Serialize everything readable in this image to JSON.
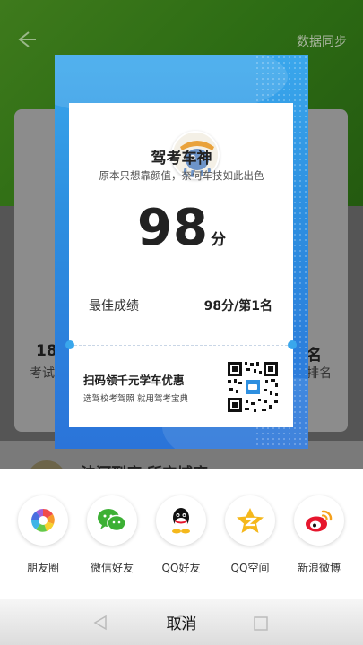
{
  "background": {
    "sync_label": "数据同步",
    "stat_left_value": "18",
    "stat_left_label": "考试",
    "stat_right_value": "名",
    "stat_right_label": "排名",
    "lower_text": "法河到底 所宁域度"
  },
  "poster": {
    "title": "驾考车神",
    "subtitle": "原本只想靠颜值，奈何车技如此出色",
    "score": "98",
    "score_unit": "分",
    "best_label": "最佳成绩",
    "best_value": "98分/第1名",
    "promo_title": "扫码领千元学车优惠",
    "promo_subtitle": "选驾校考驾照 就用驾考宝典"
  },
  "share": {
    "items": [
      {
        "label": "朋友圈",
        "icon": "moments-icon"
      },
      {
        "label": "微信好友",
        "icon": "wechat-icon"
      },
      {
        "label": "QQ好友",
        "icon": "qq-icon"
      },
      {
        "label": "QQ空间",
        "icon": "qzone-icon"
      },
      {
        "label": "新浪微博",
        "icon": "weibo-icon"
      }
    ],
    "cancel_label": "取消"
  },
  "colors": {
    "poster_blue": "#2d8fe0",
    "wechat_green": "#3cb034",
    "qzone_yellow": "#f5b81c",
    "weibo_red": "#e6162d"
  }
}
